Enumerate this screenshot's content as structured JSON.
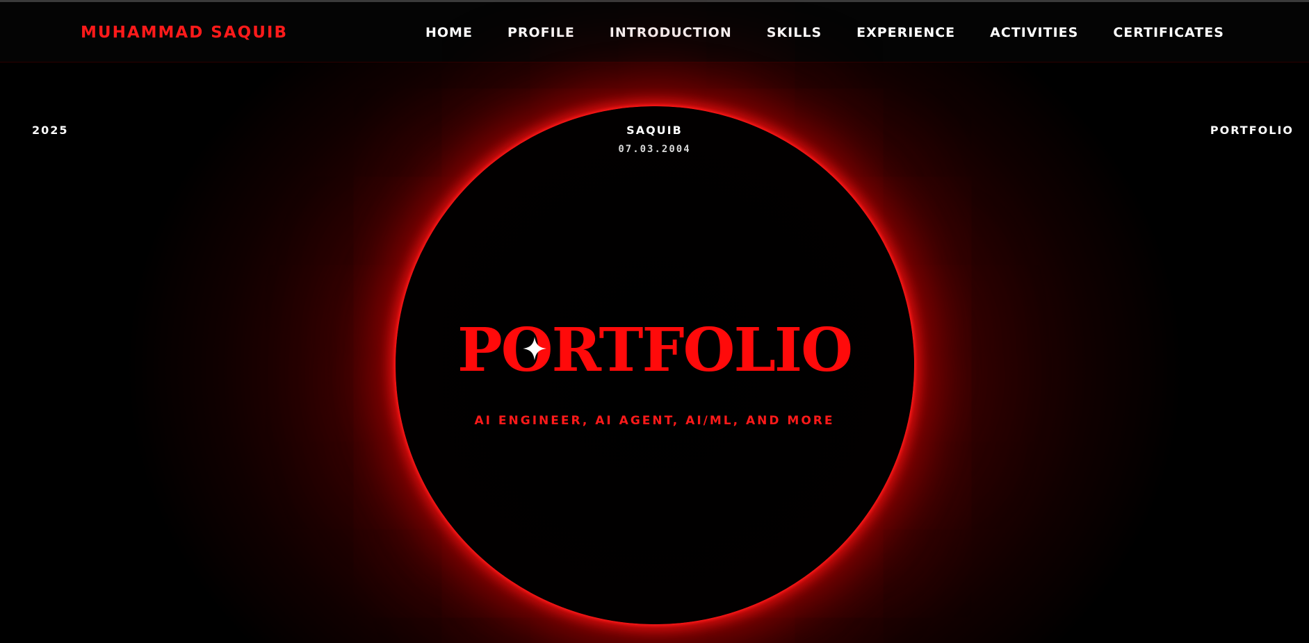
{
  "header": {
    "brand": "MUHAMMAD SAQUIB",
    "nav": [
      {
        "label": "HOME"
      },
      {
        "label": "PROFILE"
      },
      {
        "label": "INTRODUCTION"
      },
      {
        "label": "SKILLS"
      },
      {
        "label": "EXPERIENCE"
      },
      {
        "label": "ACTIVITIES"
      },
      {
        "label": "CERTIFICATES"
      }
    ]
  },
  "hero": {
    "year": "2025",
    "corner_label": "PORTFOLIO",
    "name": "SAQUIB",
    "date": "07.03.2004",
    "title": "PORTFOLIO",
    "subtitle": "AI ENGINEER, AI AGENT, AI/ML, AND MORE"
  },
  "colors": {
    "accent": "#ff0a0a",
    "background": "#000000",
    "glow": "#8a0000",
    "text": "#ffffff"
  },
  "icons": {
    "title_ornament": "four-point-star-icon"
  }
}
